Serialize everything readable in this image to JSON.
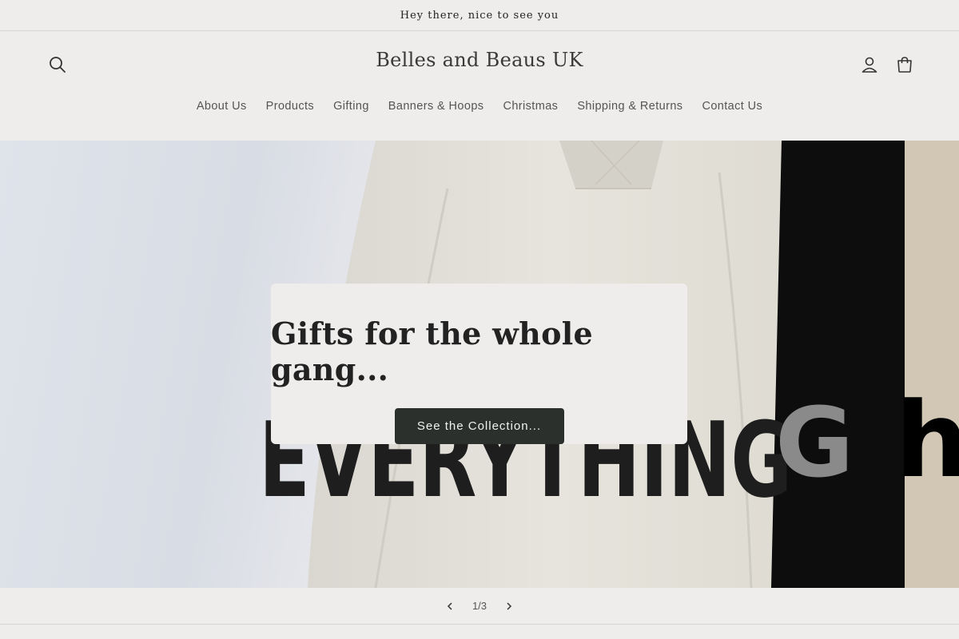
{
  "announcement": {
    "text": "Hey there, nice to see you"
  },
  "header": {
    "store_name": "Belles and Beaus UK",
    "icons": {
      "search": "search-icon",
      "account": "user-icon",
      "cart": "cart-icon"
    }
  },
  "nav": {
    "items": [
      {
        "label": "About Us"
      },
      {
        "label": "Products"
      },
      {
        "label": "Gifting"
      },
      {
        "label": "Banners & Hoops"
      },
      {
        "label": "Christmas"
      },
      {
        "label": "Shipping & Returns"
      },
      {
        "label": "Contact Us"
      }
    ]
  },
  "hero": {
    "title": "Gifts for the whole gang...",
    "cta_label": "See the Collection...",
    "image_text": "EVERYTHING"
  },
  "slider": {
    "counter": "1/3",
    "prev_icon": "chevron-left-icon",
    "next_icon": "chevron-right-icon"
  },
  "colors": {
    "background": "#eeedeb",
    "button": "#2b302c",
    "text": "#222222"
  }
}
